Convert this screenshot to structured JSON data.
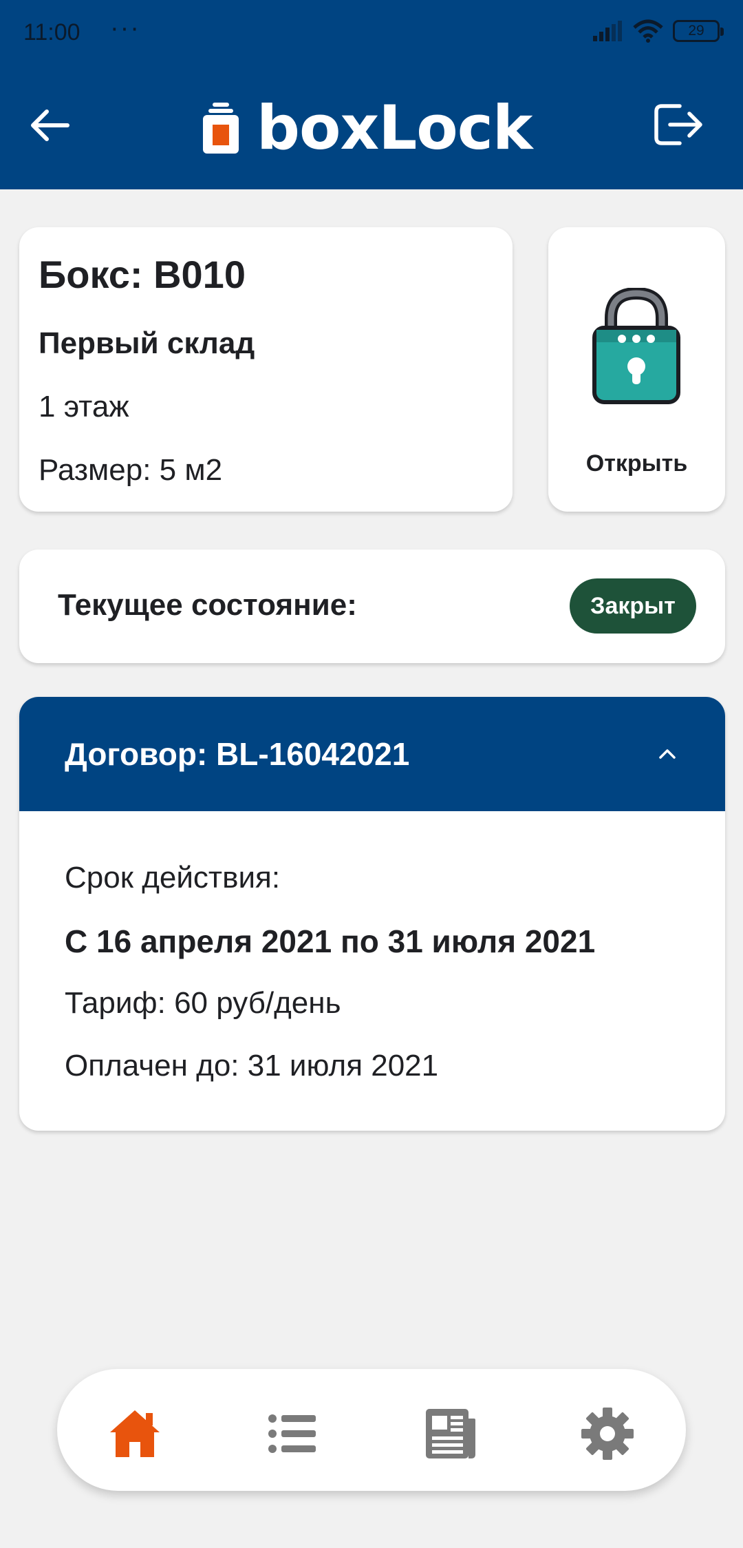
{
  "status_bar": {
    "time": "11:00",
    "dots": "···",
    "battery": "29"
  },
  "header": {
    "brand": "boxLock"
  },
  "box": {
    "title": "Бокс: B010",
    "warehouse": "Первый склад",
    "floor": "1 этаж",
    "size": "Размер: 5 м2"
  },
  "open_action": {
    "label": "Открыть"
  },
  "state": {
    "label": "Текущее состояние:",
    "value": "Закрыт"
  },
  "contract": {
    "title": "Договор: BL-16042021",
    "term_label": "Срок действия:",
    "term_value": "С 16 апреля 2021 по 31 июля 2021",
    "tariff": "Тариф: 60 руб/день",
    "paid_until": "Оплачен до: 31 июля 2021"
  },
  "nav": {
    "items": [
      "home-icon",
      "list-icon",
      "newspaper-icon",
      "gear-icon"
    ],
    "active": "home-icon"
  },
  "colors": {
    "primary": "#004482",
    "accent": "#e8540d",
    "status_closed": "#1e5239",
    "lock_body": "#26a9a0"
  }
}
